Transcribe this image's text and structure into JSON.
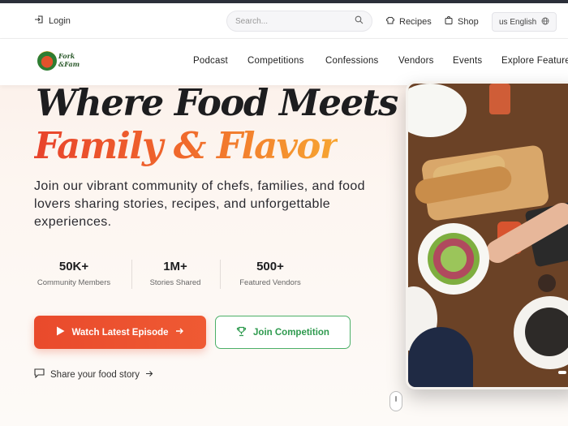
{
  "utility_bar": {
    "login_label": "Login",
    "search_placeholder": "Search...",
    "recipes_label": "Recipes",
    "shop_label": "Shop",
    "language_label": "us English"
  },
  "brand": {
    "logo_text": "Fork\n&Fam"
  },
  "nav": {
    "items": [
      "Podcast",
      "Competitions",
      "Confessions",
      "Vendors",
      "Events",
      "Explore Features"
    ]
  },
  "hero": {
    "headline_line1": "Where Food Meets",
    "headline_line2": "Family & Flavor",
    "lead": "Join our vibrant community of chefs, families, and food lovers sharing stories, recipes, and unforgettable experiences.",
    "stats": [
      {
        "value": "50K+",
        "label": "Community Members"
      },
      {
        "value": "1M+",
        "label": "Stories Shared"
      },
      {
        "value": "500+",
        "label": "Featured Vendors"
      }
    ],
    "primary_cta": "Watch Latest Episode",
    "secondary_cta": "Join Competition",
    "share_link": "Share your food story"
  },
  "colors": {
    "accent_red": "#e94a2c",
    "accent_orange": "#f7a531",
    "accent_green": "#4caf67"
  }
}
